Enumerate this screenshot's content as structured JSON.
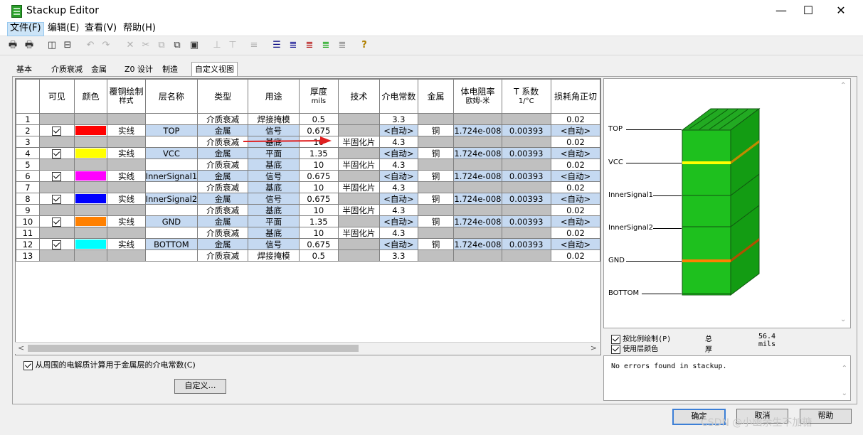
{
  "window": {
    "title": "Stackup Editor",
    "controls": [
      "—",
      "☐",
      "✕"
    ]
  },
  "menu": [
    "文件(F)",
    "编辑(E)",
    "查看(V)",
    "帮助(H)"
  ],
  "tabs": [
    "基本",
    "介质衰减",
    "金属",
    "Z0 设计",
    "制造",
    "自定义视图"
  ],
  "columns": [
    {
      "label": "",
      "sub": ""
    },
    {
      "label": "可见",
      "sub": ""
    },
    {
      "label": "颜色",
      "sub": ""
    },
    {
      "label": "覆铜绘制",
      "sub": "样式"
    },
    {
      "label": "层名称",
      "sub": ""
    },
    {
      "label": "类型",
      "sub": ""
    },
    {
      "label": "用途",
      "sub": ""
    },
    {
      "label": "厚度",
      "sub": "mils"
    },
    {
      "label": "技术",
      "sub": ""
    },
    {
      "label": "介电常数",
      "sub": ""
    },
    {
      "label": "金属",
      "sub": ""
    },
    {
      "label": "体电阻率",
      "sub": "欧姆-米"
    },
    {
      "label": "T 系数",
      "sub": "1/°C"
    },
    {
      "label": "损耗角正切",
      "sub": ""
    }
  ],
  "rows": [
    {
      "n": "1",
      "metal": false,
      "type": "介质衰减",
      "usage": "焊接掩模",
      "thick": "0.5",
      "tech": "",
      "dk": "3.3",
      "loss": "0.02"
    },
    {
      "n": "2",
      "metal": true,
      "visible": true,
      "color": "#ff0000",
      "style": "实线",
      "name": "TOP",
      "type": "金属",
      "usage": "信号",
      "thick": "0.675",
      "dk": "<自动>",
      "metalname": "铜",
      "res": "1.724e-008",
      "tc": "0.00393",
      "loss": "<自动>"
    },
    {
      "n": "3",
      "metal": false,
      "type": "介质衰减",
      "usage": "基底",
      "thick": "10",
      "tech": "半固化片",
      "dk": "4.3",
      "loss": "0.02"
    },
    {
      "n": "4",
      "metal": true,
      "visible": true,
      "color": "#ffff00",
      "style": "实线",
      "name": "VCC",
      "type": "金属",
      "usage": "平面",
      "thick": "1.35",
      "dk": "<自动>",
      "metalname": "铜",
      "res": "1.724e-008",
      "tc": "0.00393",
      "loss": "<自动>"
    },
    {
      "n": "5",
      "metal": false,
      "type": "介质衰减",
      "usage": "基底",
      "thick": "10",
      "tech": "半固化片",
      "dk": "4.3",
      "loss": "0.02"
    },
    {
      "n": "6",
      "metal": true,
      "visible": true,
      "color": "#ff00ff",
      "style": "实线",
      "name": "InnerSignal1",
      "type": "金属",
      "usage": "信号",
      "thick": "0.675",
      "dk": "<自动>",
      "metalname": "铜",
      "res": "1.724e-008",
      "tc": "0.00393",
      "loss": "<自动>"
    },
    {
      "n": "7",
      "metal": false,
      "type": "介质衰减",
      "usage": "基底",
      "thick": "10",
      "tech": "半固化片",
      "dk": "4.3",
      "loss": "0.02"
    },
    {
      "n": "8",
      "metal": true,
      "visible": true,
      "color": "#0000ff",
      "style": "实线",
      "name": "InnerSignal2",
      "type": "金属",
      "usage": "信号",
      "thick": "0.675",
      "dk": "<自动>",
      "metalname": "铜",
      "res": "1.724e-008",
      "tc": "0.00393",
      "loss": "<自动>"
    },
    {
      "n": "9",
      "metal": false,
      "type": "介质衰减",
      "usage": "基底",
      "thick": "10",
      "tech": "半固化片",
      "dk": "4.3",
      "loss": "0.02"
    },
    {
      "n": "10",
      "metal": true,
      "visible": true,
      "color": "#ff8000",
      "style": "实线",
      "name": "GND",
      "type": "金属",
      "usage": "平面",
      "thick": "1.35",
      "dk": "<自动>",
      "metalname": "铜",
      "res": "1.724e-008",
      "tc": "0.00393",
      "loss": "<自动>"
    },
    {
      "n": "11",
      "metal": false,
      "type": "介质衰减",
      "usage": "基底",
      "thick": "10",
      "tech": "半固化片",
      "dk": "4.3",
      "loss": "0.02"
    },
    {
      "n": "12",
      "metal": true,
      "visible": true,
      "color": "#00ffff",
      "style": "实线",
      "name": "BOTTOM",
      "type": "金属",
      "usage": "信号",
      "thick": "0.675",
      "dk": "<自动>",
      "metalname": "铜",
      "res": "1.724e-008",
      "tc": "0.00393",
      "loss": "<自动>"
    },
    {
      "n": "13",
      "metal": false,
      "type": "介质衰减",
      "usage": "焊接掩模",
      "thick": "0.5",
      "tech": "",
      "dk": "3.3",
      "loss": "0.02"
    }
  ],
  "options": {
    "calc_dk": "从周围的电解质计算用于金属层的介电常数(C)",
    "custom_button": "自定义…"
  },
  "preview": {
    "layers": [
      "TOP",
      "VCC",
      "InnerSignal1",
      "InnerSignal2",
      "GND",
      "BOTTOM"
    ],
    "scale_label": "按比例绘制(P)",
    "use_color_label": "使用层颜色",
    "total_label": "总厚度:",
    "total_value": "56.4 mils",
    "message": "No errors found in stackup."
  },
  "buttons": {
    "ok": "确定",
    "cancel": "取消",
    "help": "帮助"
  },
  "watermark": "CSDN @小幽余生不加糖"
}
